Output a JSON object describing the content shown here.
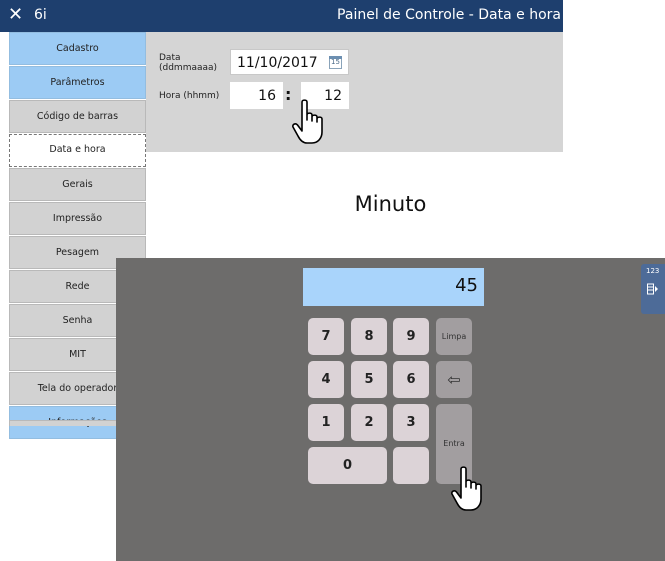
{
  "window": {
    "close_glyph": "✕",
    "app_name": "6i",
    "title": "Painel de Controle - Data e hora"
  },
  "sidebar": {
    "items": [
      {
        "label": "Cadastro",
        "style": "blue"
      },
      {
        "label": "Parâmetros",
        "style": "blue"
      },
      {
        "label": "Código de barras",
        "style": "gray"
      },
      {
        "label": "Data e hora",
        "style": "active"
      },
      {
        "label": "Gerais",
        "style": "gray"
      },
      {
        "label": "Impressão",
        "style": "gray"
      },
      {
        "label": "Pesagem",
        "style": "gray"
      },
      {
        "label": "Rede",
        "style": "gray"
      },
      {
        "label": "Senha",
        "style": "gray"
      },
      {
        "label": "MIT",
        "style": "gray"
      },
      {
        "label": "Tela do operador",
        "style": "gray"
      },
      {
        "label": "Informações",
        "style": "blue"
      }
    ]
  },
  "form": {
    "date_label": "Data\n(ddmmaaaa)",
    "date_value": "11/10/2017",
    "calendar_icon_text": "15",
    "time_label": "Hora (hhmm)",
    "hour_value": "16",
    "separator": ":",
    "minute_value": "12"
  },
  "numpad": {
    "title": "Minuto",
    "display_value": "45",
    "keys": [
      "7",
      "8",
      "9",
      "4",
      "5",
      "6",
      "1",
      "2",
      "3",
      "0"
    ],
    "clear_label": "Limpa",
    "backspace_glyph": "⇦",
    "enter_label": "Entra"
  },
  "side_tab": {
    "label": "123",
    "icon": "keyboard-toggle-icon"
  },
  "colors": {
    "titlebar": "#1e3f6e",
    "sidebar_blue": "#9ccbf4",
    "sidebar_gray": "#d2d2d2",
    "panel": "#d5d5d5",
    "numpad_bg": "#6d6c6b",
    "display": "#a9d4fb",
    "key": "#dcd3d7",
    "fn_key": "#a29ea0"
  }
}
